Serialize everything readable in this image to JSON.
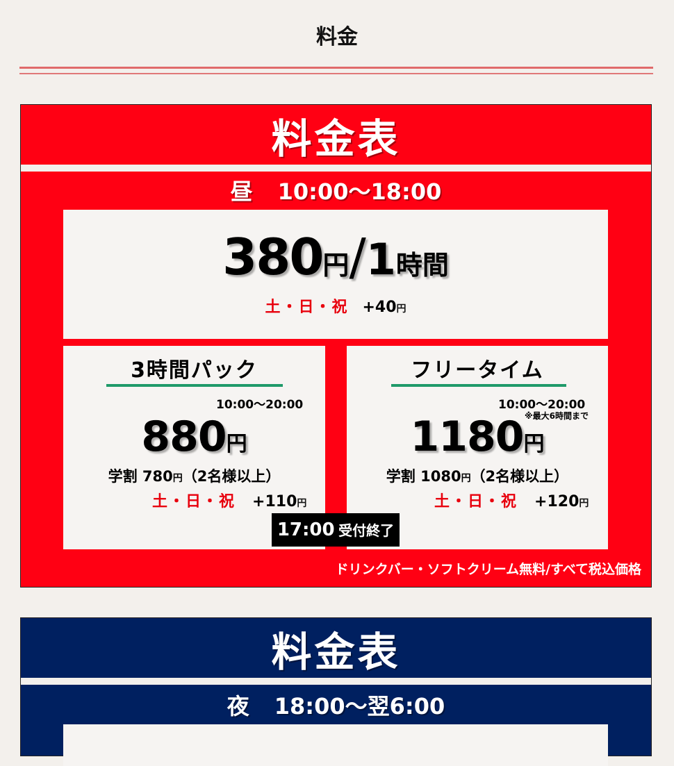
{
  "page": {
    "title": "料金"
  },
  "day_card": {
    "header": "料金表",
    "period_label": "昼",
    "period_hours": "10:00～18:00",
    "hourly": {
      "price": "380",
      "yen": "円",
      "slash": "/",
      "hours": "1",
      "hour_unit": "時間",
      "surcharge_days": "土・日・祝",
      "surcharge_amount": "+40",
      "surcharge_yen": "円"
    },
    "pack": {
      "title": "3時間パック",
      "hours": "10:00～20:00",
      "price": "880",
      "yen": "円",
      "student_label": "学割",
      "student_price": "780",
      "student_yen": "円",
      "student_condition": "（2名様以上）",
      "surcharge_days": "土・日・祝",
      "surcharge_amount": "+110",
      "surcharge_yen": "円"
    },
    "freetime": {
      "title": "フリータイム",
      "hours": "10:00～20:00",
      "note": "※最大6時間まで",
      "price": "1180",
      "yen": "円",
      "student_label": "学割",
      "student_price": "1080",
      "student_yen": "円",
      "student_condition": "（2名様以上）",
      "surcharge_days": "土・日・祝",
      "surcharge_amount": "+120",
      "surcharge_yen": "円"
    },
    "cutoff": {
      "time": "17:00",
      "label": "受付終了"
    },
    "footnote": "ドリンクバー・ソフトクリーム無料/すべて税込価格"
  },
  "night_card": {
    "header": "料金表",
    "period_label": "夜",
    "period_hours": "18:00～翌6:00"
  },
  "colors": {
    "day_red": "#ff0013",
    "night_navy": "#002060",
    "accent_green": "#1f9a6a",
    "surcharge_red": "#e8000d",
    "background": "#f3f0ec"
  }
}
